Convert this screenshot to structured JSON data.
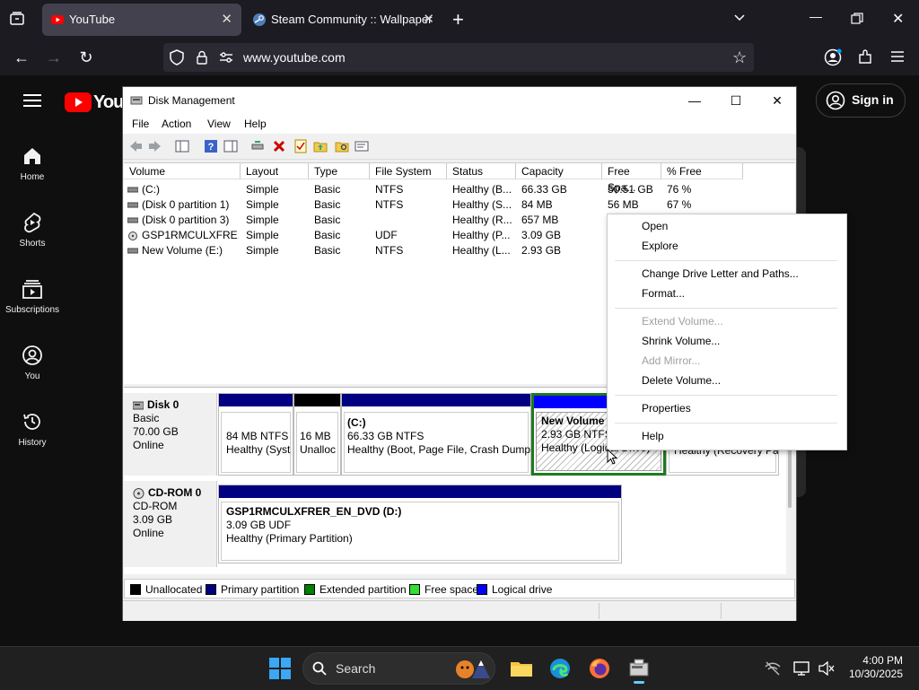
{
  "browser": {
    "tabs": [
      {
        "label": "YouTube",
        "active": true
      },
      {
        "label": "Steam Community :: Wallpaper",
        "active": false
      }
    ],
    "url": "www.youtube.com"
  },
  "youtube": {
    "logo_text": "YouT",
    "sidebar": [
      {
        "label": "Home",
        "icon": "home-icon"
      },
      {
        "label": "Shorts",
        "icon": "shorts-icon"
      },
      {
        "label": "Subscriptions",
        "icon": "subscriptions-icon"
      },
      {
        "label": "You",
        "icon": "you-icon"
      },
      {
        "label": "History",
        "icon": "history-icon"
      }
    ],
    "sign_in": "Sign in"
  },
  "disk_management": {
    "title": "Disk Management",
    "menus": [
      "File",
      "Action",
      "View",
      "Help"
    ],
    "columns": [
      "Volume",
      "Layout",
      "Type",
      "File System",
      "Status",
      "Capacity",
      "Free Spa...",
      "% Free"
    ],
    "volumes": [
      {
        "volume": "(C:)",
        "layout": "Simple",
        "type": "Basic",
        "fs": "NTFS",
        "status": "Healthy (B...",
        "capacity": "66.33 GB",
        "free": "50.51 GB",
        "pct": "76 %"
      },
      {
        "volume": "(Disk 0 partition 1)",
        "layout": "Simple",
        "type": "Basic",
        "fs": "NTFS",
        "status": "Healthy (S...",
        "capacity": "84 MB",
        "free": "56 MB",
        "pct": "67 %"
      },
      {
        "volume": "(Disk 0 partition 3)",
        "layout": "Simple",
        "type": "Basic",
        "fs": "",
        "status": "Healthy (R...",
        "capacity": "657 MB",
        "free": "",
        "pct": ""
      },
      {
        "volume": "GSP1RMCULXFRE...",
        "layout": "Simple",
        "type": "Basic",
        "fs": "UDF",
        "status": "Healthy (P...",
        "capacity": "3.09 GB",
        "free": "",
        "pct": ""
      },
      {
        "volume": "New Volume (E:)",
        "layout": "Simple",
        "type": "Basic",
        "fs": "NTFS",
        "status": "Healthy (L...",
        "capacity": "2.93 GB",
        "free": "",
        "pct": ""
      }
    ],
    "disk0": {
      "name": "Disk 0",
      "type": "Basic",
      "size": "70.00 GB",
      "state": "Online",
      "partitions": [
        {
          "line1": "",
          "line2": "84 MB NTFS",
          "line3": "Healthy (Syst"
        },
        {
          "line1": "",
          "line2": "16 MB",
          "line3": "Unalloc"
        },
        {
          "line1": "(C:)",
          "line2": "66.33 GB NTFS",
          "line3": "Healthy (Boot, Page File, Crash Dump"
        },
        {
          "line1": "New Volume",
          "line2": "2.93 GB NTFS",
          "line3": "Healthy (Logical Drive)"
        },
        {
          "line1": "",
          "line2": "",
          "line3": "Healthy (Recovery Pa"
        }
      ]
    },
    "cdrom0": {
      "name": "CD-ROM 0",
      "type": "CD-ROM",
      "size": "3.09 GB",
      "state": "Online",
      "partition": {
        "line1": "GSP1RMCULXFRER_EN_DVD  (D:)",
        "line2": "3.09 GB UDF",
        "line3": "Healthy (Primary Partition)"
      }
    },
    "legend": [
      {
        "label": "Unallocated",
        "color": "#000000"
      },
      {
        "label": "Primary partition",
        "color": "#000080"
      },
      {
        "label": "Extended partition",
        "color": "#008000"
      },
      {
        "label": "Free space",
        "color": "#33dd33"
      },
      {
        "label": "Logical drive",
        "color": "#0000ff"
      }
    ]
  },
  "context_menu": {
    "items": [
      "Open",
      "Explore",
      "Change Drive Letter and Paths...",
      "Format...",
      "Extend Volume...",
      "Shrink Volume...",
      "Add Mirror...",
      "Delete Volume...",
      "Properties",
      "Help"
    ]
  },
  "taskbar": {
    "search": "Search",
    "time": "4:00 PM",
    "date": "10/30/2025"
  }
}
